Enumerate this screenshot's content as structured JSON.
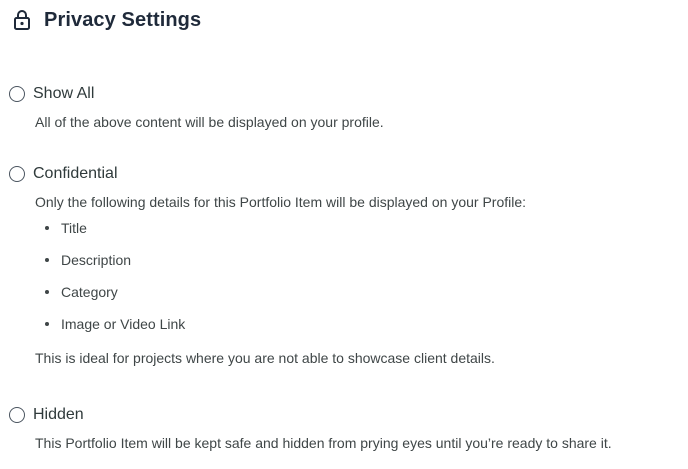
{
  "header": {
    "title": "Privacy Settings",
    "icon": "lock-icon"
  },
  "options": [
    {
      "label": "Show All",
      "selected": false,
      "description": "All of the above content will be displayed on your profile."
    },
    {
      "label": "Confidential",
      "selected": false,
      "description": "Only the following details for this Portfolio Item will be displayed on your Profile:",
      "bullets": [
        "Title",
        "Description",
        "Category",
        "Image or Video Link"
      ],
      "note": "This is ideal for projects where you are not able to showcase client details."
    },
    {
      "label": "Hidden",
      "selected": false,
      "description": "This Portfolio Item will be kept safe and hidden from prying eyes until you’re ready to share it."
    }
  ]
}
